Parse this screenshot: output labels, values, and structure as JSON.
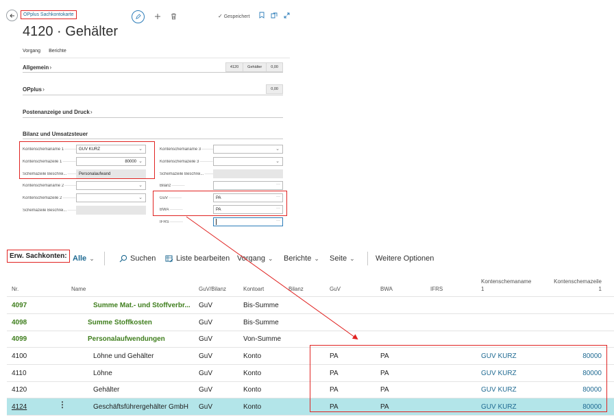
{
  "card": {
    "caption": "OPplus Sachkontokarte",
    "title": "4120 · Gehälter",
    "saved_text": "Gespeichert",
    "tabs": [
      "Vorgang",
      "Berichte"
    ]
  },
  "sections": {
    "allgemein": {
      "label": "Allgemein",
      "chips": [
        "4120",
        "Gehälter",
        "0,00"
      ]
    },
    "opplus": {
      "label": "OPplus",
      "chips": [
        "0,00"
      ]
    },
    "posten": {
      "label": "Postenanzeige und Druck"
    },
    "bilanz": {
      "label": "Bilanz und Umsatzsteuer"
    }
  },
  "fields_left": [
    {
      "label": "Kontenschemaname 1",
      "value": "GUV KURZ",
      "kind": "dropdown"
    },
    {
      "label": "Kontenschemazeile 1",
      "value": "80000",
      "kind": "dropdown-right"
    },
    {
      "label": "Schemazeile Beschrei...",
      "value": "Personalaufwand",
      "kind": "readonly"
    },
    {
      "label": "Kontenschemaname 2",
      "value": "",
      "kind": "dropdown"
    },
    {
      "label": "Kontenschemazeile 2",
      "value": "",
      "kind": "dropdown"
    },
    {
      "label": "Schemazeile Beschrei...",
      "value": "",
      "kind": "readonly"
    }
  ],
  "fields_right": [
    {
      "label": "Kontenschemaname 3",
      "value": "",
      "kind": "dropdown"
    },
    {
      "label": "Kontenschemazeile 3",
      "value": "",
      "kind": "dropdown"
    },
    {
      "label": "Schemazeile Beschrei...",
      "value": "",
      "kind": "readonly"
    },
    {
      "label": "Bilanz",
      "value": "",
      "kind": "lookup"
    },
    {
      "label": "GuV",
      "value": "PA",
      "kind": "lookup"
    },
    {
      "label": "BWA",
      "value": "PA",
      "kind": "lookup"
    },
    {
      "label": "IFRS",
      "value": "",
      "kind": "lookup-focus"
    }
  ],
  "list": {
    "title": "Erw. Sachkonten:",
    "filter": "Alle",
    "actions": {
      "search": "Suchen",
      "edit_list": "Liste bearbeiten",
      "vorgang": "Vorgang",
      "berichte": "Berichte",
      "seite": "Seite",
      "more": "Weitere Optionen"
    },
    "columns": {
      "nr": "Nr.",
      "name": "Name",
      "guv_bilanz": "GuV/Bilanz",
      "kontoart": "Kontoart",
      "bilanz": "Bilanz",
      "guv": "GuV",
      "bwa": "BWA",
      "ifrs": "IFRS",
      "schemaname_1": "Kontenschemaname",
      "schemaname_2": "1",
      "schemazeile_1": "Kontenschemazeile",
      "schemazeile_2": "1"
    },
    "rows": [
      {
        "nr": "4097",
        "name": "Summe Mat.- und Stoffverbr...",
        "guv_bilanz": "GuV",
        "kontoart": "Bis-Summe",
        "guv": "",
        "bwa": "",
        "schemaname": "",
        "schemazeile": "",
        "style": "green",
        "indent": 2
      },
      {
        "nr": "4098",
        "name": "Summe Stoffkosten",
        "guv_bilanz": "GuV",
        "kontoart": "Bis-Summe",
        "guv": "",
        "bwa": "",
        "schemaname": "",
        "schemazeile": "",
        "style": "green",
        "indent": 1
      },
      {
        "nr": "4099",
        "name": "Personalaufwendungen",
        "guv_bilanz": "GuV",
        "kontoart": "Von-Summe",
        "guv": "",
        "bwa": "",
        "schemaname": "",
        "schemazeile": "",
        "style": "green",
        "indent": 1
      },
      {
        "nr": "4100",
        "name": "Löhne und Gehälter",
        "guv_bilanz": "GuV",
        "kontoart": "Konto",
        "guv": "PA",
        "bwa": "PA",
        "schemaname": "GUV KURZ",
        "schemazeile": "80000",
        "style": "normal",
        "indent": 2
      },
      {
        "nr": "4110",
        "name": "Löhne",
        "guv_bilanz": "GuV",
        "kontoart": "Konto",
        "guv": "PA",
        "bwa": "PA",
        "schemaname": "GUV KURZ",
        "schemazeile": "80000",
        "style": "normal",
        "indent": 2
      },
      {
        "nr": "4120",
        "name": "Gehälter",
        "guv_bilanz": "GuV",
        "kontoart": "Konto",
        "guv": "PA",
        "bwa": "PA",
        "schemaname": "GUV KURZ",
        "schemazeile": "80000",
        "style": "normal",
        "indent": 2
      },
      {
        "nr": "4124",
        "name": "Geschäftsführergehälter GmbH",
        "guv_bilanz": "GuV",
        "kontoart": "Konto",
        "guv": "PA",
        "bwa": "PA",
        "schemaname": "GUV KURZ",
        "schemazeile": "80000",
        "style": "selected",
        "indent": 2
      }
    ]
  },
  "colors": {
    "accent": "#1f6a92",
    "green": "#3f7e1d",
    "highlight_red": "#e0211f",
    "selected_row": "#b3e5e9"
  }
}
